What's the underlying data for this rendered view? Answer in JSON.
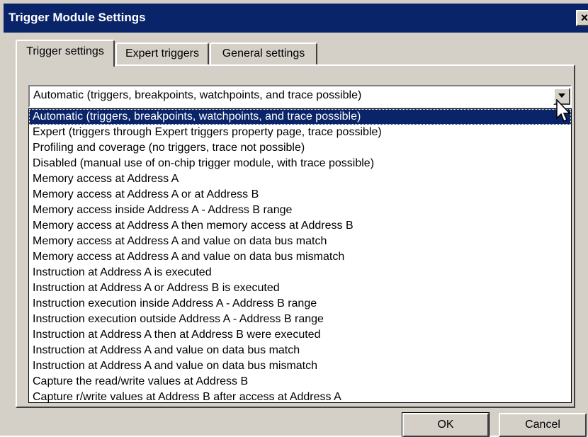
{
  "window": {
    "title": "Trigger Module Settings",
    "close_label": "×"
  },
  "tabs": [
    {
      "label": "Trigger settings",
      "active": true
    },
    {
      "label": "Expert triggers",
      "active": false
    },
    {
      "label": "General settings",
      "active": false
    }
  ],
  "mode_select": {
    "value": "Automatic (triggers, breakpoints, watchpoints, and trace possible)",
    "options": [
      "Automatic (triggers, breakpoints, watchpoints, and trace possible)",
      "Expert (triggers through Expert triggers property page, trace possible)",
      "Profiling and coverage (no triggers, trace not possible)",
      "Disabled (manual use of on-chip trigger module, with trace possible)",
      "Memory access at Address A",
      "Memory access at Address A or at Address B",
      "Memory access inside Address A - Address B range",
      "Memory access at Address A then memory access at Address B",
      "Memory access at Address A and value on data bus match",
      "Memory access at Address A and value on data bus mismatch",
      "Instruction at Address A is executed",
      "Instruction at Address A or Address B is executed",
      "Instruction execution inside Address A - Address B range",
      "Instruction execution outside Address A - Address B range",
      "Instruction at Address A then at Address B were executed",
      "Instruction at Address A and value on data bus match",
      "Instruction at Address A and value on data bus mismatch",
      "Capture the read/write values at Address B",
      "Capture r/write values at Address B after access at Address A"
    ],
    "selected_index": 0
  },
  "buttons": {
    "ok": "OK",
    "cancel": "Cancel"
  },
  "colors": {
    "titlebar": "#0a246a",
    "dialog_face": "#d4d0c8",
    "selection": "#0a246a"
  }
}
